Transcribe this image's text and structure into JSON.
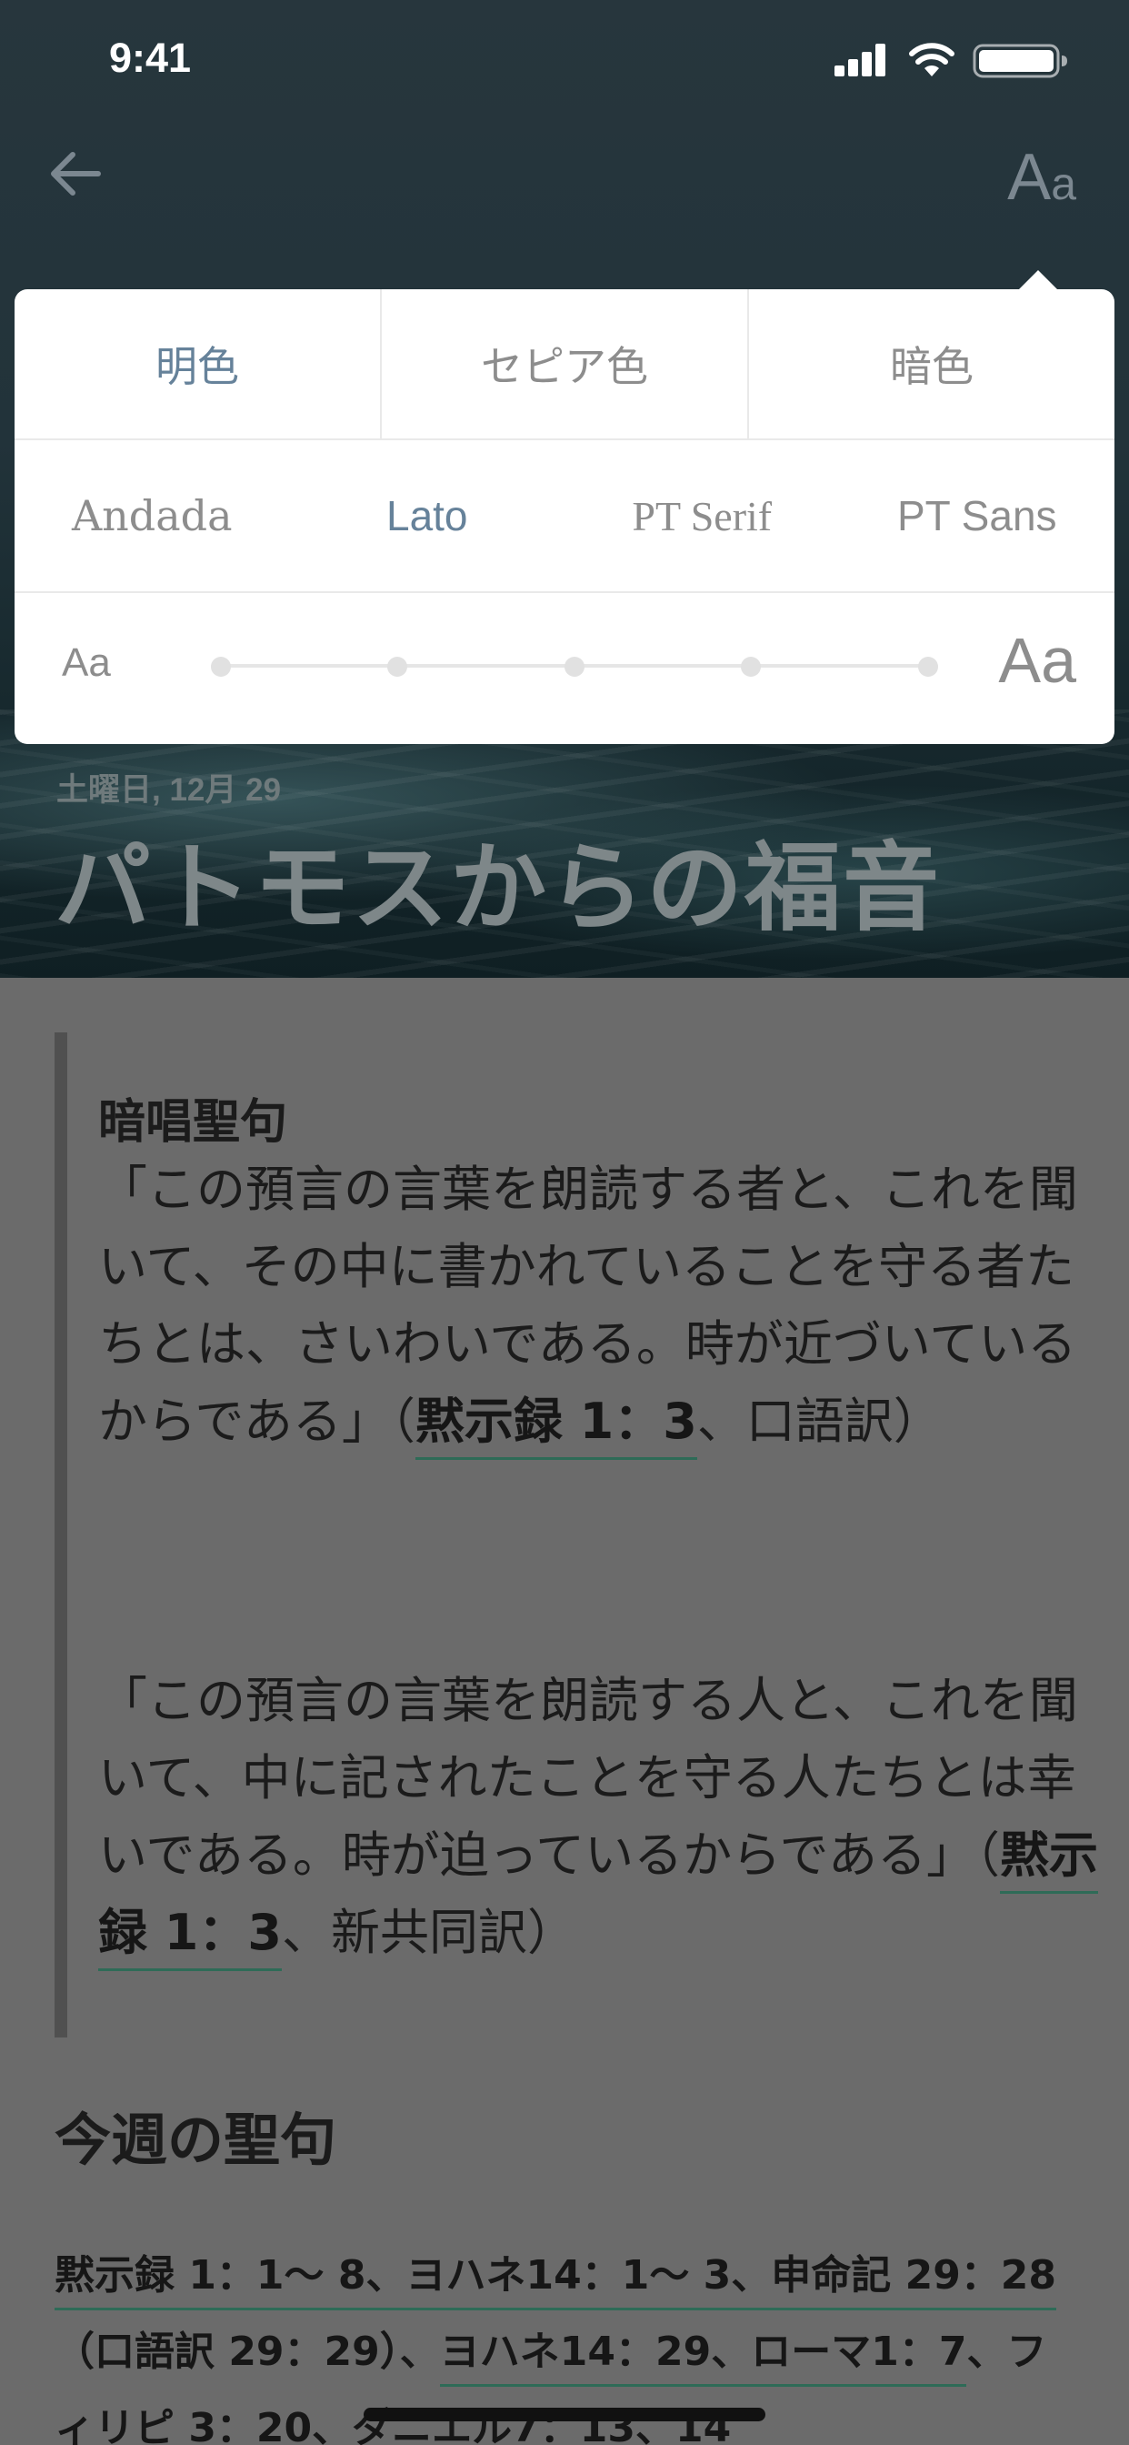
{
  "status_bar": {
    "time": "9:41"
  },
  "nav": {
    "font_settings_label_big": "A",
    "font_settings_label_small": "a"
  },
  "appearance": {
    "themes": [
      "明色",
      "セピア色",
      "暗色"
    ],
    "selected_theme": "明色",
    "fonts": [
      "Andada",
      "Lato",
      "PT Serif",
      "PT Sans"
    ],
    "selected_font": "Lato",
    "size_small_label": "Aa",
    "size_large_label": "Aa",
    "size_steps": 5,
    "selected_size_step": null
  },
  "hero": {
    "date": "土曜日, 12月 29",
    "title": "パトモスからの福音"
  },
  "memory_verse": {
    "heading": "暗唱聖句",
    "para1_text": "「この預言の言葉を朗読する者と、これを聞いて、その中に書かれていることを守る者たちとは、さいわいである。時が近づいているからである」（",
    "para1_ref": "黙示録 1：3",
    "para1_tail": "、口語訳）",
    "para2_text": "「この預言の言葉を朗読する人と、これを聞いて、中に記されたことを守る人たちとは幸いである。時が迫っているからである」（",
    "para2_ref": "黙示録 1：3",
    "para2_tail": "、新共同訳）"
  },
  "week": {
    "heading": "今週の聖句",
    "ref1": "黙示録 1：1〜 8、ヨハネ14：1〜 3、申命記 29：28",
    "ref1_paren": "（口語訳 29：29）、",
    "ref2": "ヨハネ14：29、ローマ1：7",
    "ref2_tail": "、フィリピ 3：20、ダニエル7：13、14"
  }
}
